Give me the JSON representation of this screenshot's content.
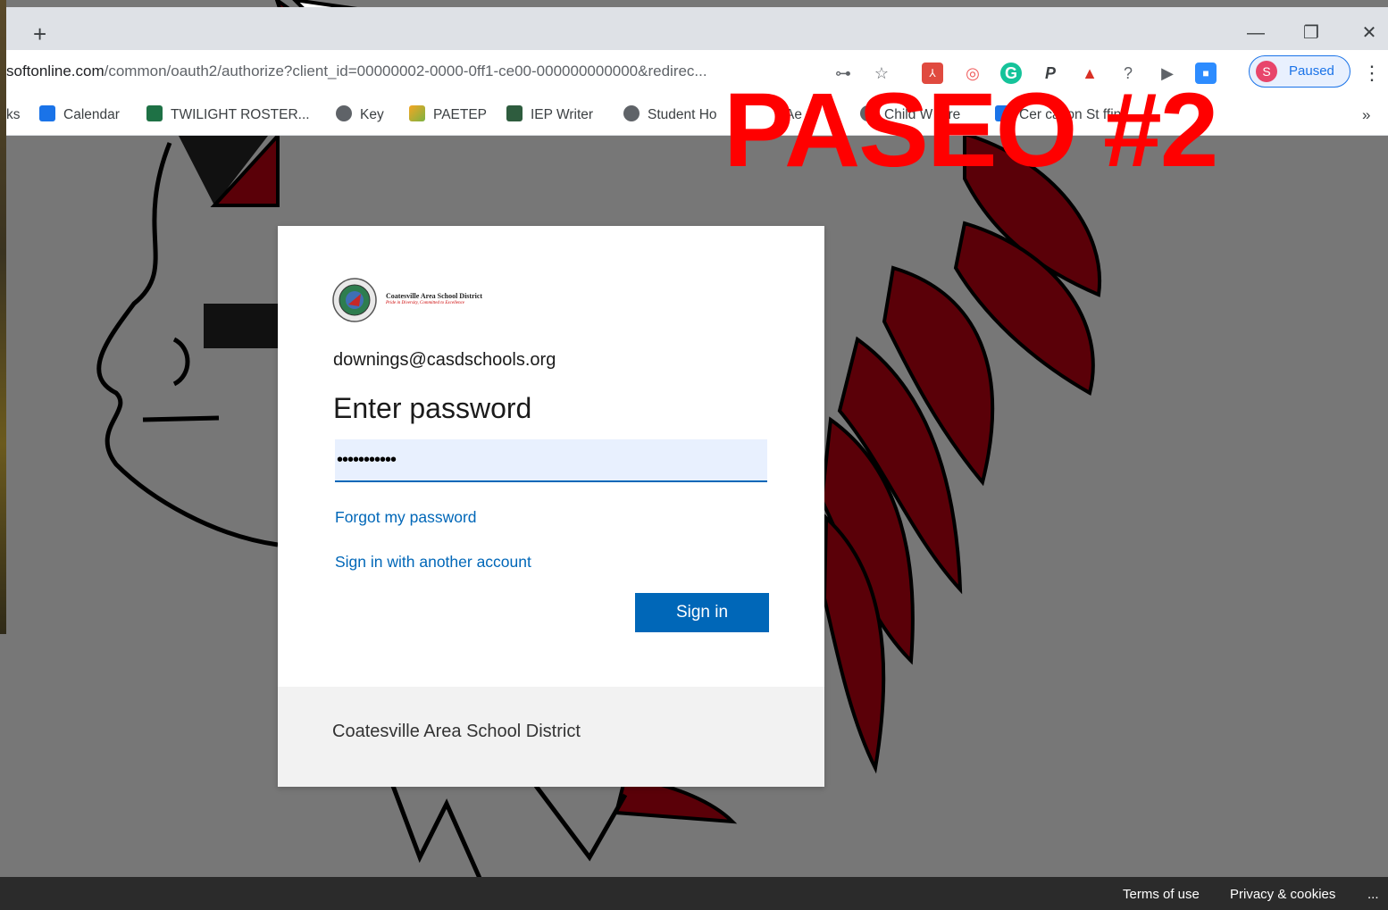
{
  "browser": {
    "new_tab_label": "+",
    "window_controls": {
      "minimize": "—",
      "restore": "❐",
      "close": "✕"
    },
    "address": {
      "domain": "softonline.com",
      "path": "/common/oauth2/authorize?client_id=00000002-0000-0ff1-ce00-000000000000&redirec..."
    },
    "toolbar_icons": [
      "key-icon",
      "star-icon",
      "acrobat-icon",
      "extension-icon",
      "grammarly-icon",
      "p-icon",
      "pen-icon",
      "help-icon",
      "media-icon",
      "zoom-icon"
    ],
    "profile": {
      "initial": "S",
      "status": "Paused"
    },
    "menu_label": "⋮"
  },
  "bookmarks": {
    "items": [
      {
        "label": "ks",
        "icon": "none"
      },
      {
        "label": "Calendar",
        "icon": "calendar-icon"
      },
      {
        "label": "TWILIGHT ROSTER...",
        "icon": "excel-icon"
      },
      {
        "label": "Key",
        "icon": "globe-icon"
      },
      {
        "label": "PAETEP",
        "icon": "pen-icon"
      },
      {
        "label": "IEP Writer",
        "icon": "iep-icon"
      },
      {
        "label": "Student Ho",
        "icon": "globe-icon"
      },
      {
        "label": "Ae",
        "icon": "extension-icon"
      },
      {
        "label": "Child W  fare",
        "icon": "globe-icon"
      },
      {
        "label": "Cer  cation St  ffin",
        "icon": "shield-icon"
      }
    ],
    "overflow": "»"
  },
  "overlay": {
    "text": "PASEO #2"
  },
  "login": {
    "org_logo": {
      "name": "Coatesville Area School District",
      "tagline": "Pride in Diversity, Committed to Excellence"
    },
    "email": "downings@casdschools.org",
    "heading": "Enter password",
    "password_value": "•••••••••••",
    "forgot_link": "Forgot my password",
    "another_account_link": "Sign in with another account",
    "signin_button": "Sign in",
    "footer_text": "Coatesville Area School District"
  },
  "footer": {
    "terms": "Terms of use",
    "privacy": "Privacy & cookies",
    "more": "..."
  },
  "colors": {
    "accent": "#0067b8",
    "overlay": "#ff0000",
    "profile": "#1a73e8",
    "mascot": "#5a0008"
  }
}
